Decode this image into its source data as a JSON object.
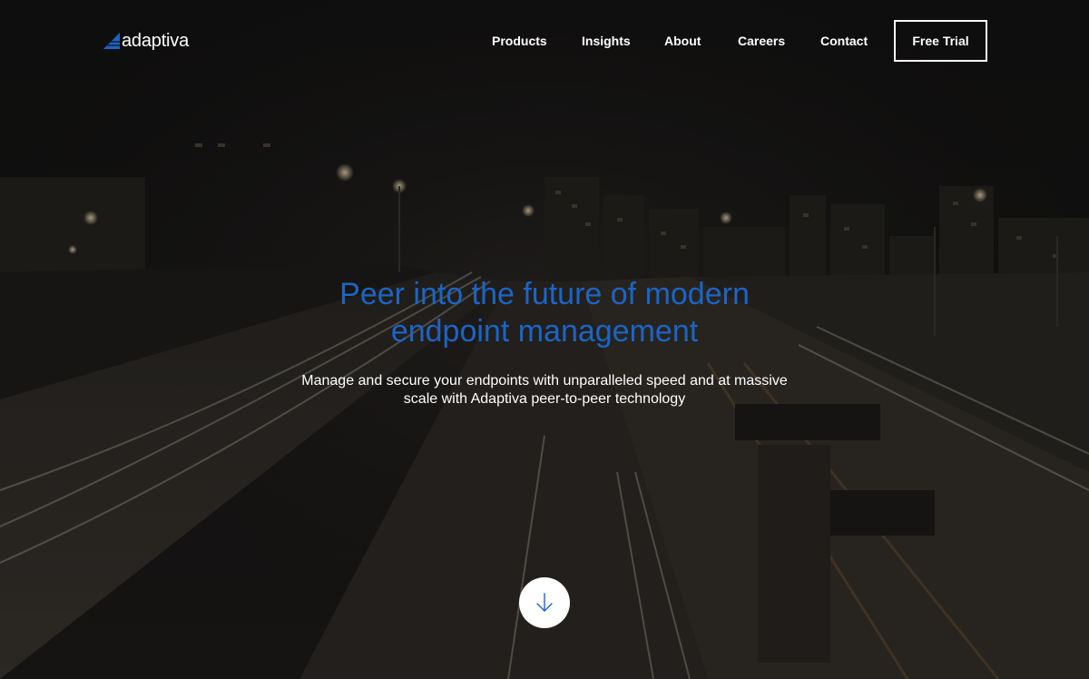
{
  "brand": {
    "name": "adaptiva",
    "accent": "#1c64c6",
    "text_color": "#ffffff",
    "background": "#141313"
  },
  "nav": {
    "items": [
      {
        "label": "Products"
      },
      {
        "label": "Insights"
      },
      {
        "label": "About"
      },
      {
        "label": "Careers"
      },
      {
        "label": "Contact"
      }
    ],
    "cta": {
      "label": "Free Trial"
    }
  },
  "hero": {
    "headline_line1": "Peer into the future of modern",
    "headline_line2": "endpoint management",
    "sub_line1": "Manage and secure your endpoints with unparalleled speed and at massive",
    "sub_line2": "scale with Adaptiva peer-to-peer technology",
    "background": "night highway with city skyline and light trails",
    "scroll_icon": "arrow-down-icon"
  }
}
